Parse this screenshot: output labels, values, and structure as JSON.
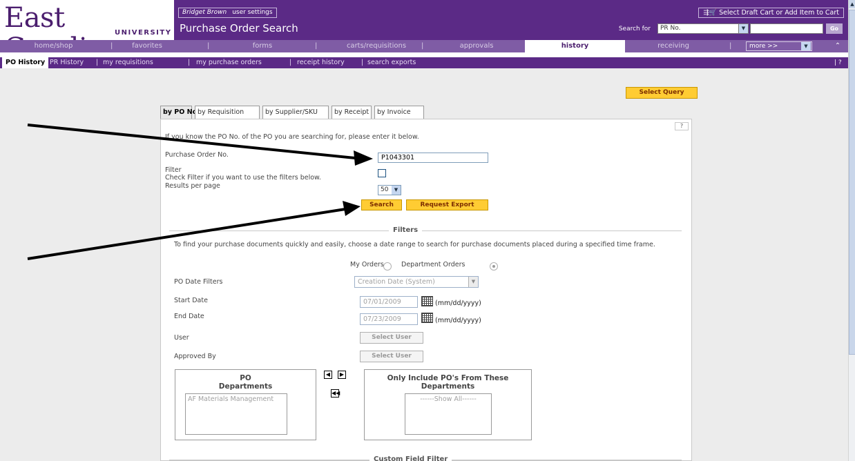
{
  "header": {
    "logo_main": "East Carolina",
    "logo_sub": "UNIVERSITY",
    "user_name": "Bridget Brown",
    "user_settings": "user settings",
    "page_title": "Purchase Order Search",
    "cart_label": "Select Draft Cart or Add Item to Cart",
    "search_for_label": "Search for",
    "search_type": "PR No.",
    "go_label": "Go"
  },
  "nav": {
    "items": [
      "home/shop",
      "favorites",
      "forms",
      "carts/requisitions",
      "approvals",
      "history",
      "receiving"
    ],
    "separator": "|",
    "more_label": "more >>"
  },
  "subnav": {
    "items": [
      "PO History",
      "PR History",
      "my requisitions",
      "my purchase orders",
      "receipt history",
      "search exports"
    ],
    "separator": "|",
    "help": "| ?"
  },
  "main": {
    "select_query_label": "Select Query",
    "tabs": [
      "by PO No.",
      "by Requisition",
      "by Supplier/SKU",
      "by Receipt",
      "by Invoice"
    ],
    "help": "?",
    "intro_text": "If you know the PO No. of the PO you are searching for, please enter it below.",
    "po_number_label": "Purchase Order No.",
    "po_number_value": "P1043301",
    "filter_label": "Filter",
    "filter_hint": "Check Filter if you want to use the filters below.",
    "results_label": "Results per page",
    "results_value": "50",
    "search_button": "Search",
    "export_button": "Request Export",
    "filters_title": "Filters",
    "filters_desc": "To find your purchase documents quickly and easily, choose a date range to search for purchase documents placed during a specified time frame.",
    "my_orders_label": "My Orders",
    "dept_orders_label": "Department Orders",
    "po_date_filters_label": "PO Date Filters",
    "po_date_filter_value": "Creation Date (System)",
    "start_date_label": "Start Date",
    "start_date_value": "07/01/2009",
    "end_date_label": "End Date",
    "end_date_value": "07/23/2009",
    "date_format": "(mm/dd/yyyy)",
    "user_label": "User",
    "select_user_label": "Select User",
    "approved_by_label": "Approved By",
    "select_user_label_2": "Select User",
    "po_departments_title_1": "PO",
    "po_departments_title_2": "Departments",
    "po_departments_items": [
      "AF Materials Management"
    ],
    "only_include_title_1": "Only Include PO's From These",
    "only_include_title_2": "Departments",
    "only_include_items": [
      "------Show All------"
    ],
    "custom_field_title": "Custom Field Filter"
  }
}
